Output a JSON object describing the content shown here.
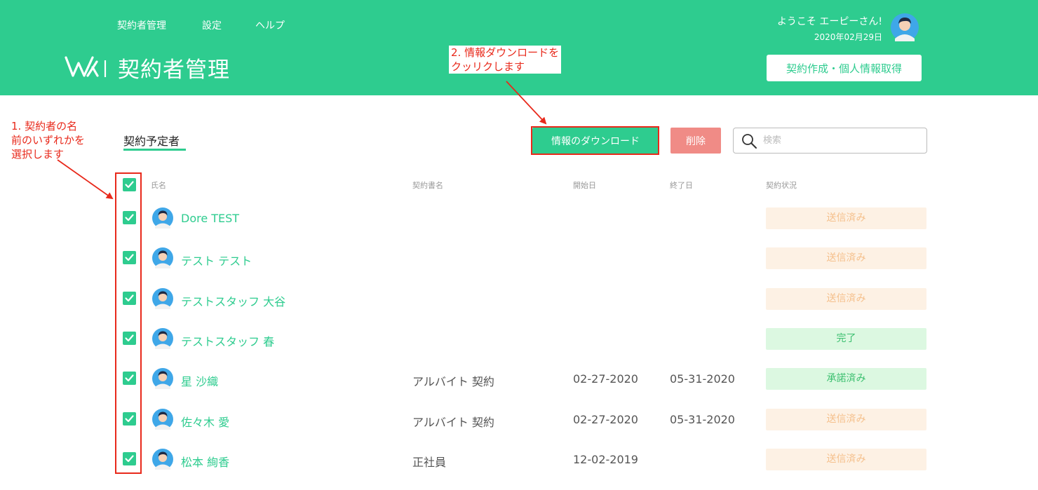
{
  "nav": {
    "items": [
      "契約者管理",
      "設定",
      "ヘルプ"
    ]
  },
  "app": {
    "title": "契約者管理"
  },
  "user": {
    "welcome": "ようこそ エーピーさん!",
    "date": "2020年02月29日"
  },
  "header": {
    "create_button": "契約作成・個人情報取得"
  },
  "section": {
    "tab_label": "契約予定者"
  },
  "toolbar": {
    "download_label": "情報のダウンロード",
    "delete_label": "削除",
    "search_placeholder": "検索"
  },
  "table": {
    "columns": [
      "氏名",
      "契約書名",
      "開始日",
      "終了日",
      "契約状況"
    ],
    "rows": [
      {
        "name": "Dore TEST",
        "contract": "",
        "start": "",
        "end": "",
        "status": "送信済み",
        "status_type": "sent",
        "checked": true
      },
      {
        "name": "テスト テスト",
        "contract": "",
        "start": "",
        "end": "",
        "status": "送信済み",
        "status_type": "sent",
        "checked": true
      },
      {
        "name": "テストスタッフ 大谷",
        "contract": "",
        "start": "",
        "end": "",
        "status": "送信済み",
        "status_type": "sent",
        "checked": true
      },
      {
        "name": "テストスタッフ 春",
        "contract": "",
        "start": "",
        "end": "",
        "status": "完了",
        "status_type": "done",
        "checked": true
      },
      {
        "name": "星 沙織",
        "contract": "アルバイト 契約",
        "start": "02-27-2020",
        "end": "05-31-2020",
        "status": "承諾済み",
        "status_type": "accepted",
        "checked": true
      },
      {
        "name": "佐々木 愛",
        "contract": "アルバイト 契約",
        "start": "02-27-2020",
        "end": "05-31-2020",
        "status": "送信済み",
        "status_type": "sent",
        "checked": true
      },
      {
        "name": "松本 絢香",
        "contract": "正社員",
        "start": "12-02-2019",
        "end": "",
        "status": "送信済み",
        "status_type": "sent",
        "checked": true
      }
    ]
  },
  "annotations": {
    "step1": [
      "1. 契約者の名",
      "前のいずれかを",
      "選択します"
    ],
    "step2": [
      "2. 情報ダウンロードを",
      "クッリクします"
    ]
  },
  "colors": {
    "brand": "#2ecc8f",
    "danger": "#f08b86",
    "annotation": "#e8291b",
    "status_sent_bg": "#fdf1e4",
    "status_sent_text": "#f5c08c",
    "status_done_bg": "#dcf8e1",
    "status_done_text": "#3bbf6f"
  },
  "icons": {
    "search": "search-icon",
    "check": "check-icon",
    "avatar": "avatar-icon"
  }
}
